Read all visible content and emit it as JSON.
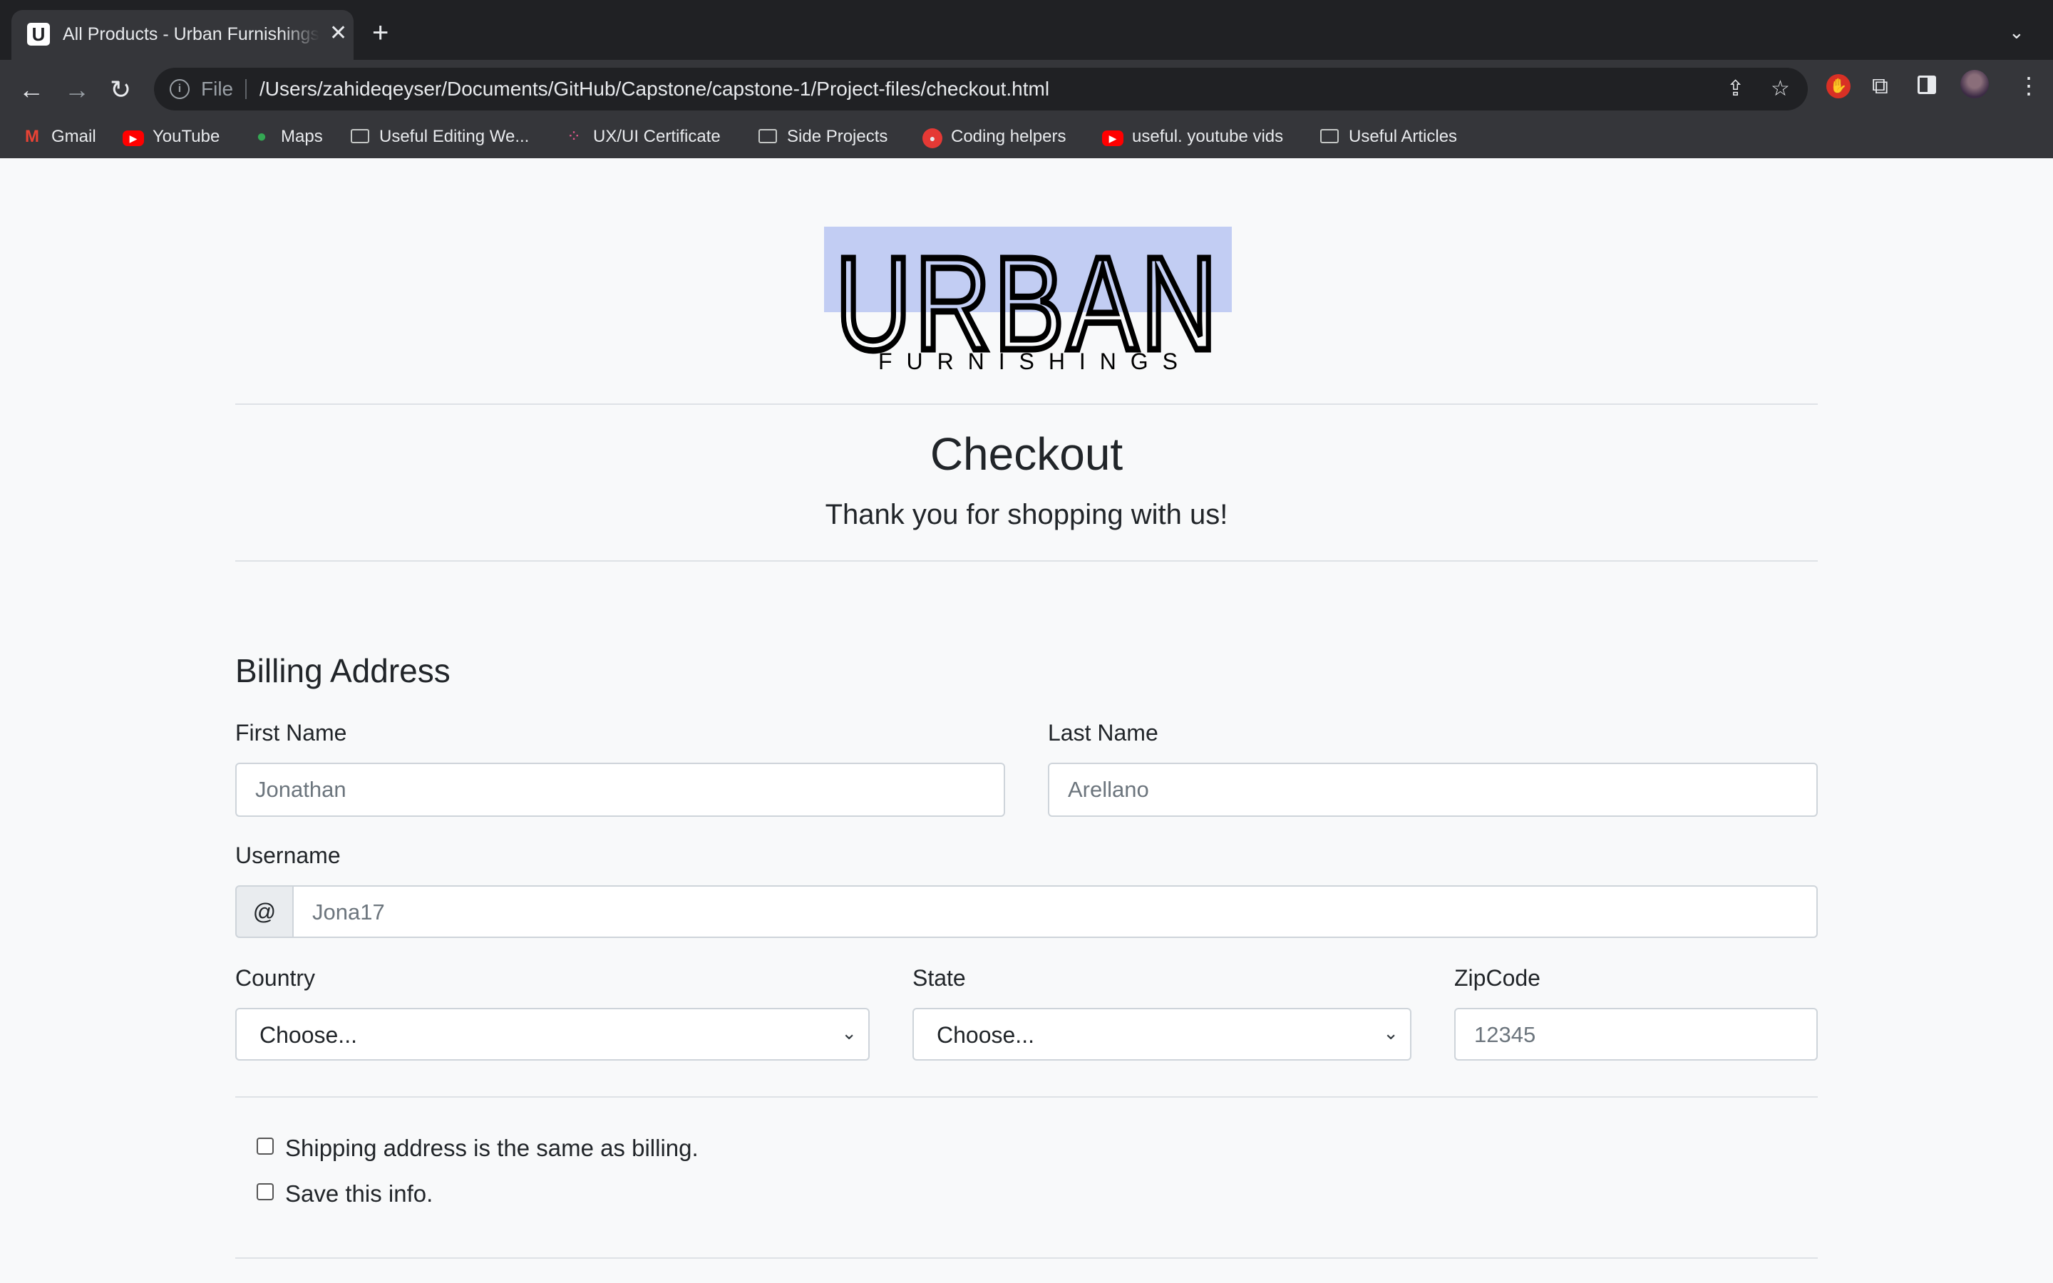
{
  "browser": {
    "tab_title": "All Products - Urban Furnishings",
    "tab_favicon": "U",
    "new_tab_symbol": "+",
    "close_symbol": "✕",
    "file_label": "File",
    "url": "/Users/zahideqeyser/Documents/GitHub/Capstone/capstone-1/Project-files/checkout.html",
    "bookmarks": [
      {
        "label": "Gmail",
        "icon": "gmail-icon"
      },
      {
        "label": "YouTube",
        "icon": "youtube-icon"
      },
      {
        "label": "Maps",
        "icon": "maps-icon"
      },
      {
        "label": "Useful Editing We...",
        "icon": "folder-icon"
      },
      {
        "label": "UX/UI Certificate",
        "icon": "dots-icon"
      },
      {
        "label": "Side Projects",
        "icon": "folder-icon"
      },
      {
        "label": "Coding helpers",
        "icon": "coding-icon"
      },
      {
        "label": "useful. youtube vids",
        "icon": "youtube-icon"
      },
      {
        "label": "Useful Articles",
        "icon": "folder-icon"
      }
    ]
  },
  "page": {
    "logo": {
      "main": "URBAN",
      "sub": "FURNISHINGS"
    },
    "title": "Checkout",
    "subtitle": "Thank you for shopping with us!",
    "billing": {
      "heading": "Billing Address",
      "first_name": {
        "label": "First Name",
        "placeholder": "Jonathan"
      },
      "last_name": {
        "label": "Last Name",
        "placeholder": "Arellano"
      },
      "username": {
        "label": "Username",
        "prefix": "@",
        "placeholder": "Jona17"
      },
      "country": {
        "label": "Country",
        "value": "Choose..."
      },
      "state": {
        "label": "State",
        "value": "Choose..."
      },
      "zip": {
        "label": "ZipCode",
        "placeholder": "12345"
      },
      "checkbox_same": "Shipping address is the same as billing.",
      "checkbox_save": "Save this info."
    }
  },
  "colors": {
    "chrome_dark": "#202124",
    "chrome_toolbar": "#35363a",
    "logo_highlight": "#c2cdf3",
    "page_bg": "#f8f9fa"
  }
}
